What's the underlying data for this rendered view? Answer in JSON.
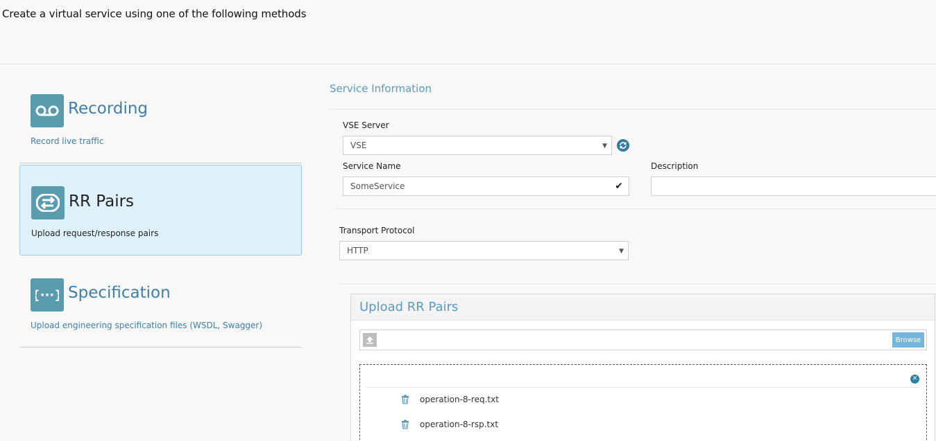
{
  "page": {
    "title": "Create a virtual service using one of the following methods"
  },
  "methods": [
    {
      "title": "Recording",
      "description": "Record live traffic",
      "icon": "tape-icon",
      "selected": false
    },
    {
      "title": "RR Pairs",
      "description": "Upload request/response pairs",
      "icon": "swap-arrows-icon",
      "selected": true
    },
    {
      "title": "Specification",
      "description": "Upload engineering specification files (WSDL, Swagger)",
      "icon": "curly-braces-icon",
      "selected": false
    }
  ],
  "service_info": {
    "section_title": "Service Information",
    "vse_server": {
      "label": "VSE Server",
      "value": "VSE"
    },
    "service_name": {
      "label": "Service Name",
      "value": "SomeService"
    },
    "description": {
      "label": "Description",
      "value": ""
    },
    "transport": {
      "label": "Transport Protocol",
      "value": "HTTP"
    }
  },
  "upload": {
    "title": "Upload RR Pairs",
    "browse_label": "Browse",
    "files": [
      "operation-8-req.txt",
      "operation-8-rsp.txt"
    ]
  },
  "colors": {
    "accent": "#3f7fa8",
    "icon_bg": "#5a9bb0",
    "selected_bg": "#dff1fb",
    "button": "#75b6dc"
  }
}
